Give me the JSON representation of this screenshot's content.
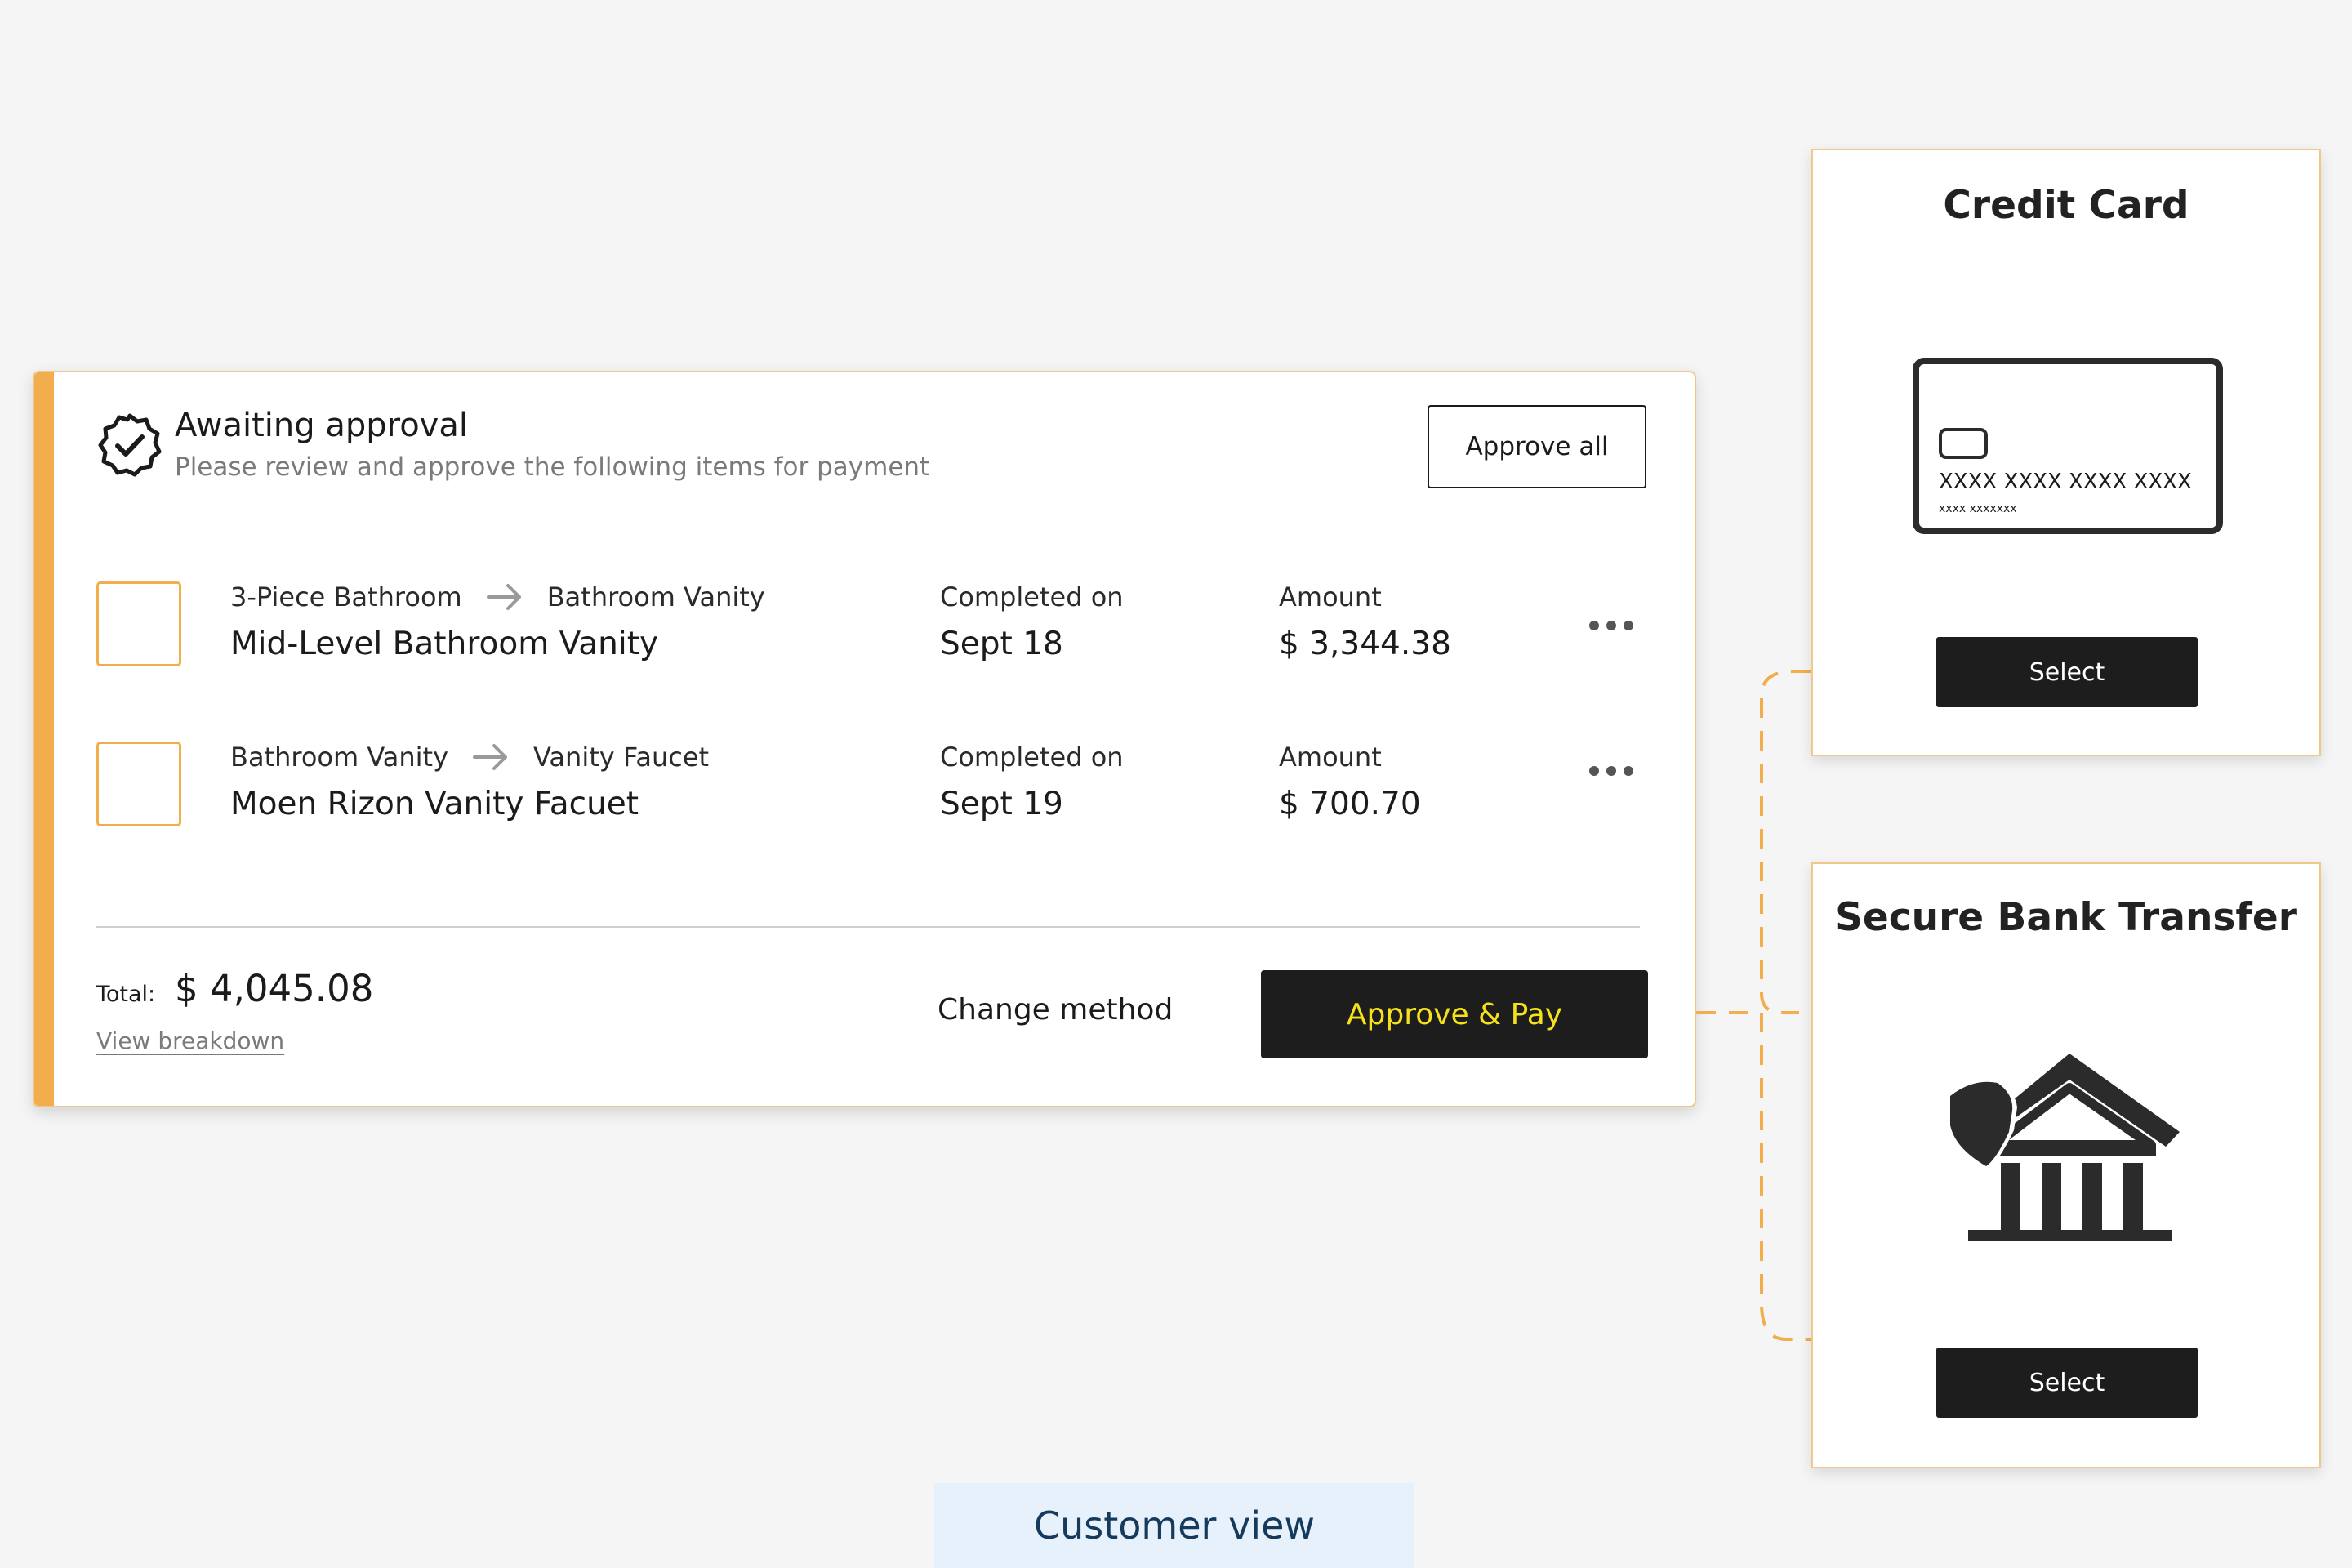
{
  "approval": {
    "title": "Awaiting approval",
    "subtitle": "Please review and approve the following items for payment",
    "approve_all_label": "Approve all",
    "items": [
      {
        "from": "3-Piece Bathroom",
        "to": "Bathroom Vanity",
        "name": "Mid-Level Bathroom Vanity",
        "completed_label": "Completed on",
        "completed_value": "Sept 18",
        "amount_label": "Amount",
        "amount_value": "$ 3,344.38"
      },
      {
        "from": "Bathroom Vanity",
        "to": "Vanity Faucet",
        "name": "Moen Rizon Vanity Facuet",
        "completed_label": "Completed on",
        "completed_value": "Sept 19",
        "amount_label": "Amount",
        "amount_value": "$ 700.70"
      }
    ],
    "total_label": "Total:",
    "total_value": "$ 4,045.08",
    "breakdown_label": "View breakdown",
    "change_method_label": "Change method",
    "approve_pay_label": "Approve & Pay"
  },
  "payment_methods": {
    "credit_card": {
      "title": "Credit Card",
      "card_number": "XXXX XXXX XXXX XXXX",
      "card_meta": "xxxx  xxxxxxx",
      "select_label": "Select"
    },
    "bank_transfer": {
      "title": "Secure Bank Transfer",
      "select_label": "Select"
    }
  },
  "view_label": "Customer view",
  "colors": {
    "accent": "#f2ae4c",
    "button_dark": "#1d1d1d",
    "approve_text": "#f5e21b",
    "badge_bg": "#e6f1fb",
    "badge_text": "#153a5b"
  }
}
